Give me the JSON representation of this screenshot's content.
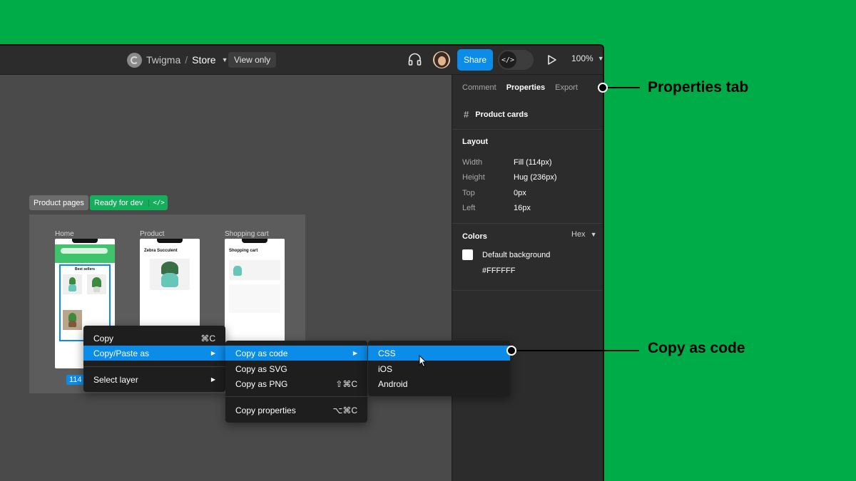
{
  "colors": {
    "page_bg": "#00ac47",
    "accent": "#0c8ce9",
    "ready_green": "#14ae5c"
  },
  "topbar": {
    "team_icon": "team-logo-icon",
    "team": "Twigma",
    "separator": "/",
    "file": "Store",
    "view_only": "View only",
    "share": "Share",
    "dev_mode_icon": "</>",
    "zoom": "100%"
  },
  "panel": {
    "tabs": [
      "Comment",
      "Properties",
      "Export"
    ],
    "layer_icon": "#",
    "layer_name": "Product cards",
    "layout": {
      "title": "Layout",
      "props": [
        {
          "label": "Width",
          "value": "Fill (114px)"
        },
        {
          "label": "Height",
          "value": "Hug (236px)"
        },
        {
          "label": "Top",
          "value": "0px"
        },
        {
          "label": "Left",
          "value": "16px"
        }
      ]
    },
    "colors": {
      "title": "Colors",
      "format": "Hex",
      "swatch_name": "Default background",
      "swatch_hex": "#FFFFFF"
    }
  },
  "canvas": {
    "section_tag": "Product pages",
    "status_tag": "Ready for dev",
    "status_icon": "</>",
    "frames": [
      {
        "label": "Home",
        "heading": "Best sellers"
      },
      {
        "label": "Product",
        "heading": "Zebra Succulent"
      },
      {
        "label": "Shopping cart",
        "heading": "Shopping cart"
      }
    ],
    "selection_badge": "114"
  },
  "menus": {
    "main": [
      {
        "label": "Copy",
        "shortcut": "⌘C"
      },
      {
        "label": "Copy/Paste as",
        "submenu": true
      },
      {
        "label": "Select layer",
        "submenu": true
      }
    ],
    "copy_paste_as": [
      {
        "label": "Copy as code",
        "submenu": true
      },
      {
        "label": "Copy as SVG"
      },
      {
        "label": "Copy as PNG",
        "shortcut": "⇧⌘C"
      },
      {
        "label": "Copy properties",
        "shortcut": "⌥⌘C"
      }
    ],
    "copy_as_code": [
      {
        "label": "CSS"
      },
      {
        "label": "iOS"
      },
      {
        "label": "Android"
      }
    ],
    "submenu_arrow": "▶"
  },
  "callouts": {
    "properties_tab": "Properties tab",
    "copy_as_code": "Copy as code"
  }
}
